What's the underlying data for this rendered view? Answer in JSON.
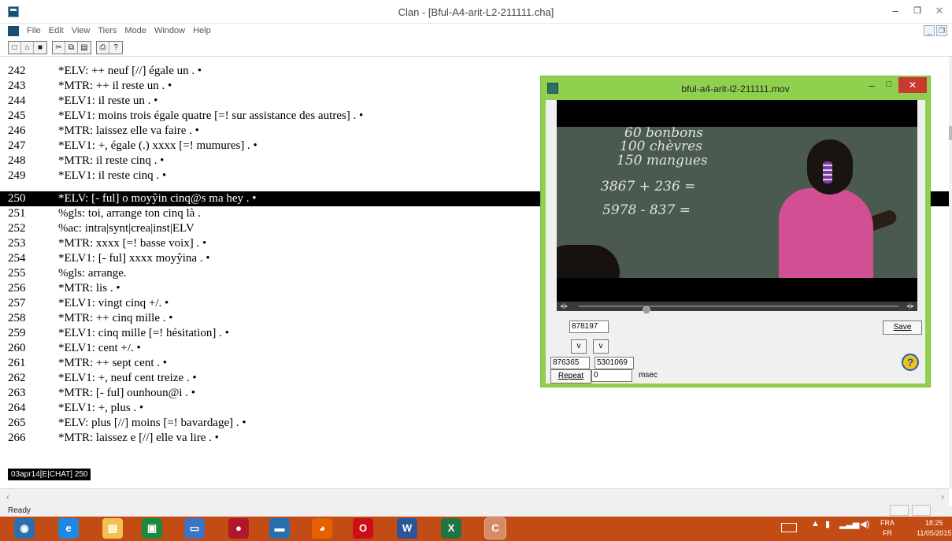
{
  "window": {
    "title": "Clan - [Bful-A4-arit-L2-211111.cha]",
    "minimize": "–",
    "maximize": "❐",
    "close": "✕"
  },
  "menu": {
    "items": [
      "File",
      "Edit",
      "View",
      "Tiers",
      "Mode",
      "Window",
      "Help"
    ],
    "mdi_minimize": "_",
    "mdi_restore": "❐"
  },
  "toolbar": {
    "buttons": [
      {
        "name": "new",
        "glyph": "□"
      },
      {
        "name": "open",
        "glyph": "⌂"
      },
      {
        "name": "save",
        "glyph": "■"
      },
      {
        "name": "cut",
        "glyph": "✂"
      },
      {
        "name": "copy",
        "glyph": "⧉"
      },
      {
        "name": "paste",
        "glyph": "▤"
      },
      {
        "name": "print",
        "glyph": "⎙"
      },
      {
        "name": "help",
        "glyph": "?"
      }
    ]
  },
  "transcript": {
    "selected_line": "250",
    "lines": [
      {
        "num": "242",
        "text": "*ELV:   ++ neuf [//] égale un . •"
      },
      {
        "num": "243",
        "text": "*MTR:  ++ il reste un . •"
      },
      {
        "num": "244",
        "text": "*ELV1:  il reste un . •"
      },
      {
        "num": "245",
        "text": "*ELV1:  moins trois égale quatre [=! sur assistance des autres] . •"
      },
      {
        "num": "246",
        "text": "*MTR:  laissez elle va faire . •"
      },
      {
        "num": "247",
        "text": "*ELV1:  +, égale (.) xxxx [=! mumures] . •"
      },
      {
        "num": "248",
        "text": "*MTR:  il reste cinq . •"
      },
      {
        "num": "249",
        "text": "*ELV1:  il reste cinq . •"
      },
      {
        "num": "250",
        "text": "*ELV:  [- ful] o moyŷin cinq@s ma hey . •"
      },
      {
        "num": "251",
        "text": "%gls:  toi, arrange ton cinq là ."
      },
      {
        "num": "252",
        "text": "%ac:   intra|synt|crea|inst|ELV"
      },
      {
        "num": "253",
        "text": "*MTR:  xxxx [=! basse voix] . •"
      },
      {
        "num": "254",
        "text": "*ELV1:  [- ful] xxxx moyŷina . •"
      },
      {
        "num": "255",
        "text": "%gls:  arrange."
      },
      {
        "num": "256",
        "text": "*MTR:  lis . •"
      },
      {
        "num": "257",
        "text": "*ELV1:  vingt cinq +/. •"
      },
      {
        "num": "258",
        "text": "*MTR:  ++ cinq mille . •"
      },
      {
        "num": "259",
        "text": "*ELV1:  cinq mille [=! hésitation] . •"
      },
      {
        "num": "260",
        "text": "*ELV1:  cent +/. •"
      },
      {
        "num": "261",
        "text": "*MTR:  ++ sept cent . •"
      },
      {
        "num": "262",
        "text": "*ELV1:  +, neuf cent treize . •"
      },
      {
        "num": "263",
        "text": "*MTR:  [- ful] ounhoun@i . •"
      },
      {
        "num": "264",
        "text": "*ELV1:  +, plus . •"
      },
      {
        "num": "265",
        "text": "*ELV:  plus [//] moins [=! bavardage] . •"
      },
      {
        "num": "266",
        "text": "*MTR:  laissez e [//] elle va lire . •"
      }
    ],
    "mode_tag": "03apr14[E|CHAT]  250"
  },
  "statusbar": {
    "text": "Ready"
  },
  "media": {
    "title": "bful-a4-arit-l2-211111.mov",
    "minimize": "–",
    "maximize": "□",
    "close": "✕",
    "board_lines": [
      "60 bonbons",
      "100 chèvres",
      "150 mangues",
      "3867 + 236 =",
      "5978 - 837 ="
    ],
    "seek_left": "◂|▸",
    "seek_right": "◂|▸",
    "seek_progress": 0.2,
    "current_time": "878197",
    "save_label": "Save",
    "step_back_label": "v",
    "step_fwd_label": "v",
    "start_time": "876365",
    "end_time": "5301069",
    "repeat_label": "Repeat",
    "repeat_value": "0",
    "msec_label": "msec",
    "help_glyph": "?"
  },
  "taskbar": {
    "apps": [
      {
        "name": "start",
        "glyph": "◉",
        "color": "#2a6fb0"
      },
      {
        "name": "internet-explorer",
        "glyph": "e",
        "color": "#1e88e5"
      },
      {
        "name": "file-explorer",
        "glyph": "▤",
        "color": "#f2c14e"
      },
      {
        "name": "store",
        "glyph": "▣",
        "color": "#1a8a3c"
      },
      {
        "name": "remote-desktop",
        "glyph": "▭",
        "color": "#3a76c4"
      },
      {
        "name": "media",
        "glyph": "●",
        "color": "#b0182a"
      },
      {
        "name": "window-app",
        "glyph": "▬",
        "color": "#2a6fb0"
      },
      {
        "name": "firefox",
        "glyph": "◕",
        "color": "#e66000"
      },
      {
        "name": "opera",
        "glyph": "O",
        "color": "#cc0f16"
      },
      {
        "name": "word",
        "glyph": "W",
        "color": "#2b579a"
      },
      {
        "name": "excel",
        "glyph": "X",
        "color": "#217346"
      },
      {
        "name": "clan",
        "glyph": "C",
        "color": "#2c6e6a"
      }
    ],
    "lang_top": "FRA",
    "lang_bottom": "FR",
    "time": "18:25",
    "date": "11/05/2015"
  }
}
